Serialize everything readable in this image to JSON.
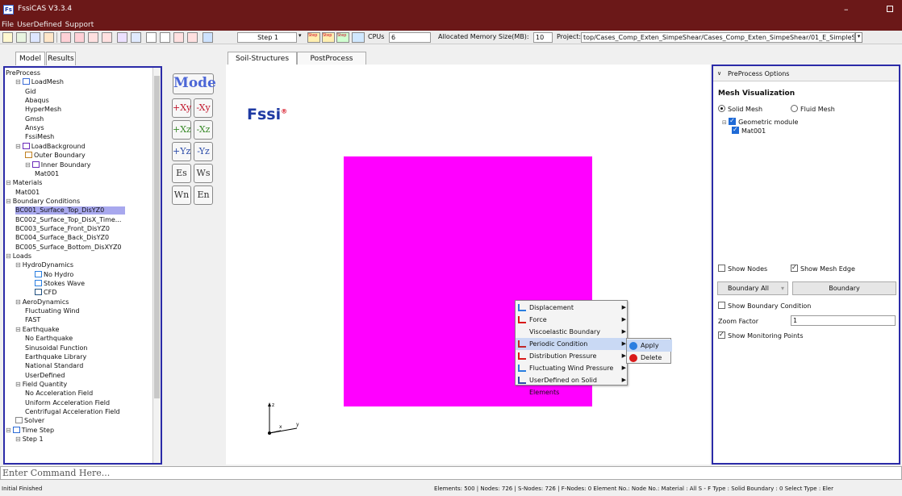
{
  "window": {
    "title": "FssiCAS V3.3.4",
    "icon_text": "Fs"
  },
  "menu": [
    "File",
    "UserDefined",
    "Support"
  ],
  "toolbar": {
    "step_value": "Step 1",
    "cpus_label": "CPUs",
    "cpus_value": "6",
    "memory_label": "Allocated Memory Size(MB):",
    "memory_value": "10",
    "project_label": "Project:",
    "project_path": "top/Cases_Comp_Exten_SimpeShear/Cases_Comp_Exten_SimpeShear/01_E_SimpleShea",
    "step_icons": [
      "Step",
      "Step",
      "Step"
    ]
  },
  "left_tabs": [
    "Model",
    "Results"
  ],
  "center_tabs": [
    "Soil-Structures",
    "PostProcess"
  ],
  "tree": [
    {
      "label": "PreProcess",
      "level": 0,
      "icon": "",
      "toggle": ""
    },
    {
      "label": "LoadMesh",
      "level": 1,
      "icon": "grid-icon",
      "toggle": "⊟"
    },
    {
      "label": "Gid",
      "level": 2,
      "icon": "",
      "toggle": ""
    },
    {
      "label": "Abaqus",
      "level": 2,
      "icon": "",
      "toggle": ""
    },
    {
      "label": "HyperMesh",
      "level": 2,
      "icon": "",
      "toggle": ""
    },
    {
      "label": "Gmsh",
      "level": 2,
      "icon": "",
      "toggle": ""
    },
    {
      "label": "Ansys",
      "level": 2,
      "icon": "",
      "toggle": ""
    },
    {
      "label": "FssiMesh",
      "level": 2,
      "icon": "",
      "toggle": ""
    },
    {
      "label": "LoadBackground",
      "level": 1,
      "icon": "shape-icon",
      "toggle": "⊟"
    },
    {
      "label": "Outer Boundary",
      "level": 2,
      "icon": "boundary-icon",
      "toggle": ""
    },
    {
      "label": "Inner Boundary",
      "level": 2,
      "icon": "shape-icon",
      "toggle": "⊟"
    },
    {
      "label": "Mat001",
      "level": 3,
      "icon": "",
      "toggle": ""
    },
    {
      "label": "Materials",
      "level": 0,
      "icon": "",
      "toggle": "⊟"
    },
    {
      "label": "Mat001",
      "level": 1,
      "icon": "",
      "toggle": ""
    },
    {
      "label": "Boundary Conditions",
      "level": 0,
      "icon": "",
      "toggle": "⊟"
    },
    {
      "label": "BC001_Surface_Top_DisYZ0",
      "level": 1,
      "icon": "",
      "toggle": "",
      "selected": true
    },
    {
      "label": "BC002_Surface_Top_DisX_Time...",
      "level": 1,
      "icon": "",
      "toggle": ""
    },
    {
      "label": "BC003_Surface_Front_DisYZ0",
      "level": 1,
      "icon": "",
      "toggle": ""
    },
    {
      "label": "BC004_Surface_Back_DisYZ0",
      "level": 1,
      "icon": "",
      "toggle": ""
    },
    {
      "label": "BC005_Surface_Bottom_DisXYZ0",
      "level": 1,
      "icon": "",
      "toggle": ""
    },
    {
      "label": "Loads",
      "level": 0,
      "icon": "",
      "toggle": "⊟"
    },
    {
      "label": "HydroDynamics",
      "level": 1,
      "icon": "",
      "toggle": "⊟"
    },
    {
      "label": "No Hydro",
      "level": 3,
      "icon": "wave-icon",
      "toggle": ""
    },
    {
      "label": "Stokes Wave",
      "level": 3,
      "icon": "wave-icon",
      "toggle": ""
    },
    {
      "label": "CFD",
      "level": 3,
      "icon": "cfd-icon",
      "toggle": ""
    },
    {
      "label": "AeroDynamics",
      "level": 1,
      "icon": "",
      "toggle": "⊟"
    },
    {
      "label": "Fluctuating Wind",
      "level": 2,
      "icon": "",
      "toggle": ""
    },
    {
      "label": "FAST",
      "level": 2,
      "icon": "",
      "toggle": ""
    },
    {
      "label": "Earthquake",
      "level": 1,
      "icon": "",
      "toggle": "⊟"
    },
    {
      "label": "No Earthquake",
      "level": 2,
      "icon": "",
      "toggle": ""
    },
    {
      "label": "Sinusoidal Function",
      "level": 2,
      "icon": "",
      "toggle": ""
    },
    {
      "label": "Earthquake Library",
      "level": 2,
      "icon": "",
      "toggle": ""
    },
    {
      "label": "National Standard",
      "level": 2,
      "icon": "",
      "toggle": ""
    },
    {
      "label": "UserDefined",
      "level": 2,
      "icon": "",
      "toggle": ""
    },
    {
      "label": "Field Quantity",
      "level": 1,
      "icon": "",
      "toggle": "⊟"
    },
    {
      "label": "No Acceleration Field",
      "level": 2,
      "icon": "",
      "toggle": ""
    },
    {
      "label": "Uniform Acceleration Field",
      "level": 2,
      "icon": "",
      "toggle": ""
    },
    {
      "label": "Centrifugal Acceleration Field",
      "level": 2,
      "icon": "",
      "toggle": ""
    },
    {
      "label": "Solver",
      "level": 1,
      "icon": "solver-icon",
      "toggle": ""
    },
    {
      "label": "Time Step",
      "level": 0,
      "icon": "clock-icon",
      "toggle": "⊟"
    },
    {
      "label": "Step 1",
      "level": 1,
      "icon": "",
      "toggle": "⊟"
    }
  ],
  "mode_button": "Mode",
  "view_buttons": [
    {
      "a": "+Xy",
      "b": "-Xy",
      "color": "red"
    },
    {
      "a": "+Xz",
      "b": "-Xz",
      "color": "green"
    },
    {
      "a": "+Yz",
      "b": "-Yz",
      "color": "blue"
    },
    {
      "a": "Es",
      "b": "Ws",
      "color": "gray"
    },
    {
      "a": "Wn",
      "b": "En",
      "color": "gray"
    }
  ],
  "logo": {
    "text": "Fssi",
    "mark": "®"
  },
  "mesh_color": "#ff00ff",
  "axes": {
    "z": "z",
    "x": "x",
    "y": "y"
  },
  "context_menu": [
    {
      "label": "Displacement",
      "icon": "displacement-icon",
      "arrow": true
    },
    {
      "label": "Force",
      "icon": "force-icon",
      "arrow": true
    },
    {
      "label": "Viscoelastic Boundary",
      "icon": "",
      "arrow": true
    },
    {
      "label": "Periodic Condition",
      "icon": "periodic-icon",
      "arrow": true,
      "highlight": true
    },
    {
      "label": "Distribution Pressure",
      "icon": "pressure-icon",
      "arrow": true
    },
    {
      "label": "Fluctuating Wind Pressure",
      "icon": "wind-icon",
      "arrow": true
    },
    {
      "label": "UserDefined on Solid Elements",
      "icon": "userdefined-icon",
      "arrow": true
    }
  ],
  "sub_menu": [
    {
      "label": "Apply",
      "icon": "apply-icon",
      "color": "#2a7ee0",
      "highlight": true
    },
    {
      "label": "Delete",
      "icon": "delete-icon",
      "color": "#d91a1a"
    }
  ],
  "right_panel": {
    "header": "PreProcess Options",
    "section_title": "Mesh Visualization",
    "solid_mesh": "Solid Mesh",
    "fluid_mesh": "Fluid Mesh",
    "geo_module": "Geometric module",
    "mat": "Mat001",
    "show_nodes": "Show Nodes",
    "show_mesh_edge": "Show Mesh Edge",
    "boundary_all": "Boundary All",
    "boundary_btn": "Boundary",
    "show_boundary_condition": "Show Boundary Condition",
    "zoom_label": "Zoom Factor",
    "zoom_value": "1",
    "show_monitoring": "Show Monitoring Points"
  },
  "command_placeholder": "Enter Command Here...",
  "status": {
    "left": "Initial Finished",
    "right": "Elements: 500 | Nodes: 726 | S-Nodes: 726 | F-Nodes: 0 Element No.:  Node No.:  Material : All  S - F Type : Solid  Boundary : 0  Select Type : Eler"
  },
  "colors": {
    "titlebar": "#6b1818",
    "selection": "#a8a8ee",
    "panel_border": "#2b2ba8"
  }
}
